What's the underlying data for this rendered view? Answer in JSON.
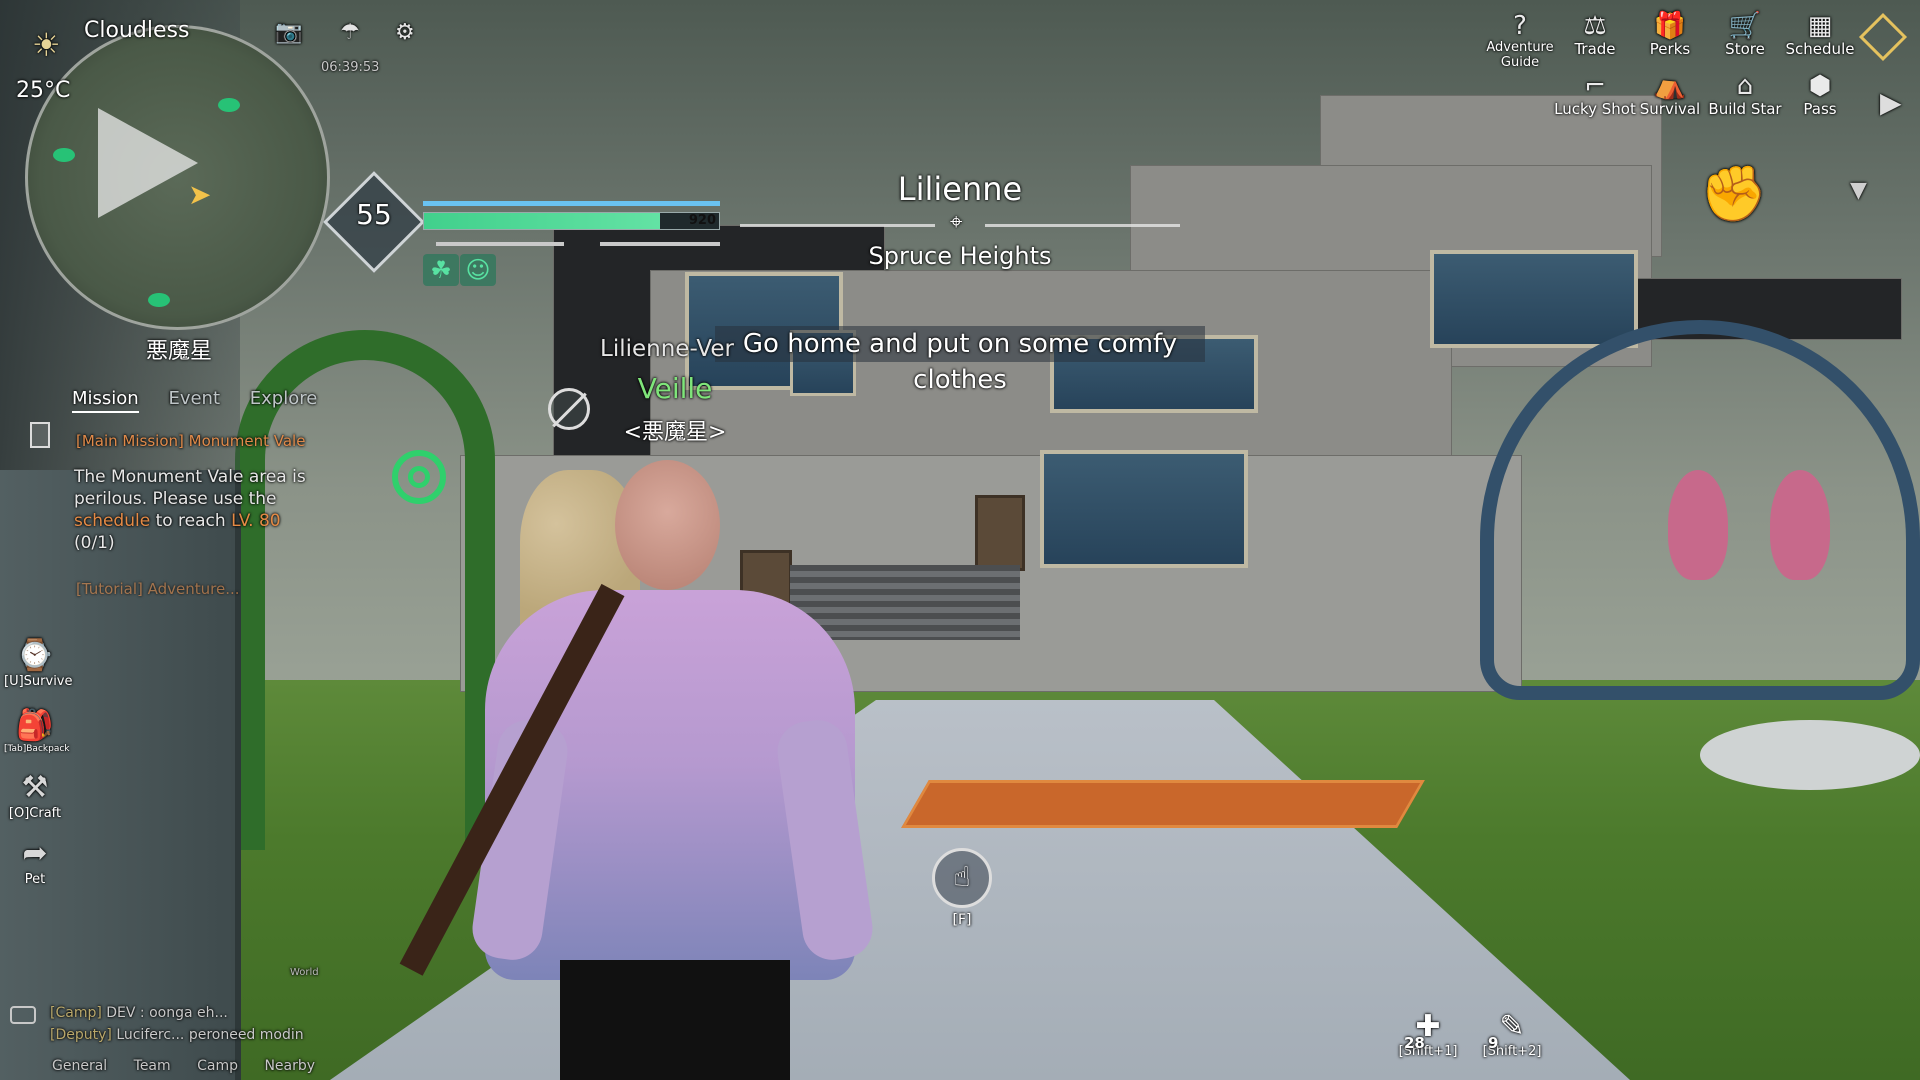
{
  "weather": {
    "label": "Cloudless",
    "temperature": "25°C",
    "time": "06:39:53"
  },
  "map": {
    "location_name": "悪魔星"
  },
  "player": {
    "level": "55",
    "hp": "920",
    "hp_fraction": 0.8
  },
  "location": {
    "name": "Lilienne",
    "subarea": "Spruce Heights"
  },
  "objective": "Go home and put on some comfy clothes",
  "npc": {
    "tag": "Lilienne-Ver",
    "name": "Veille",
    "guild": "<悪魔星>"
  },
  "mission_panel": {
    "tabs": [
      "Mission",
      "Event",
      "Explore"
    ],
    "title": "[Main Mission] Monument Vale",
    "body_1": "The Monument Vale area is perilous. Please use the ",
    "body_highlight": "schedule",
    "body_2": " to reach ",
    "body_level": "LV. 80",
    "progress": "(0/1)",
    "next_title": "[Tutorial] Adventure..."
  },
  "side_buttons": [
    {
      "label": "[U]Survive",
      "icon": "survive-icon"
    },
    {
      "label": "[Tab]Backpack",
      "icon": "backpack-icon"
    },
    {
      "label": "[O]Craft",
      "icon": "craft-icon"
    },
    {
      "label": "Pet",
      "icon": "pet-icon"
    }
  ],
  "chat": {
    "line1_channel": "[Camp]",
    "line1_text": "DEV : oonga eh...",
    "line2_channel": "[Deputy]",
    "line2_text": "Luciferc... peroneed modin",
    "world_label": "World",
    "tabs": [
      "General",
      "Team",
      "Camp",
      "Nearby"
    ]
  },
  "top_menu": {
    "row1": [
      "Adventure Guide",
      "Trade",
      "Perks",
      "Store",
      "Schedule"
    ],
    "row2": [
      "Lucky Shot",
      "Survival",
      "Build Star",
      "Pass"
    ]
  },
  "interact": {
    "key": "[F]"
  },
  "quick_slots": [
    {
      "count": "28",
      "key": "[Shift+1]",
      "icon": "medkit-icon"
    },
    {
      "count": "9",
      "key": "[Shift+2]",
      "icon": "syringe-icon"
    }
  ],
  "colors": {
    "hp": "#41d08c",
    "shield": "#6ac3f2",
    "npc_name": "#7fe57a",
    "mission_highlight": "#e58a45"
  }
}
